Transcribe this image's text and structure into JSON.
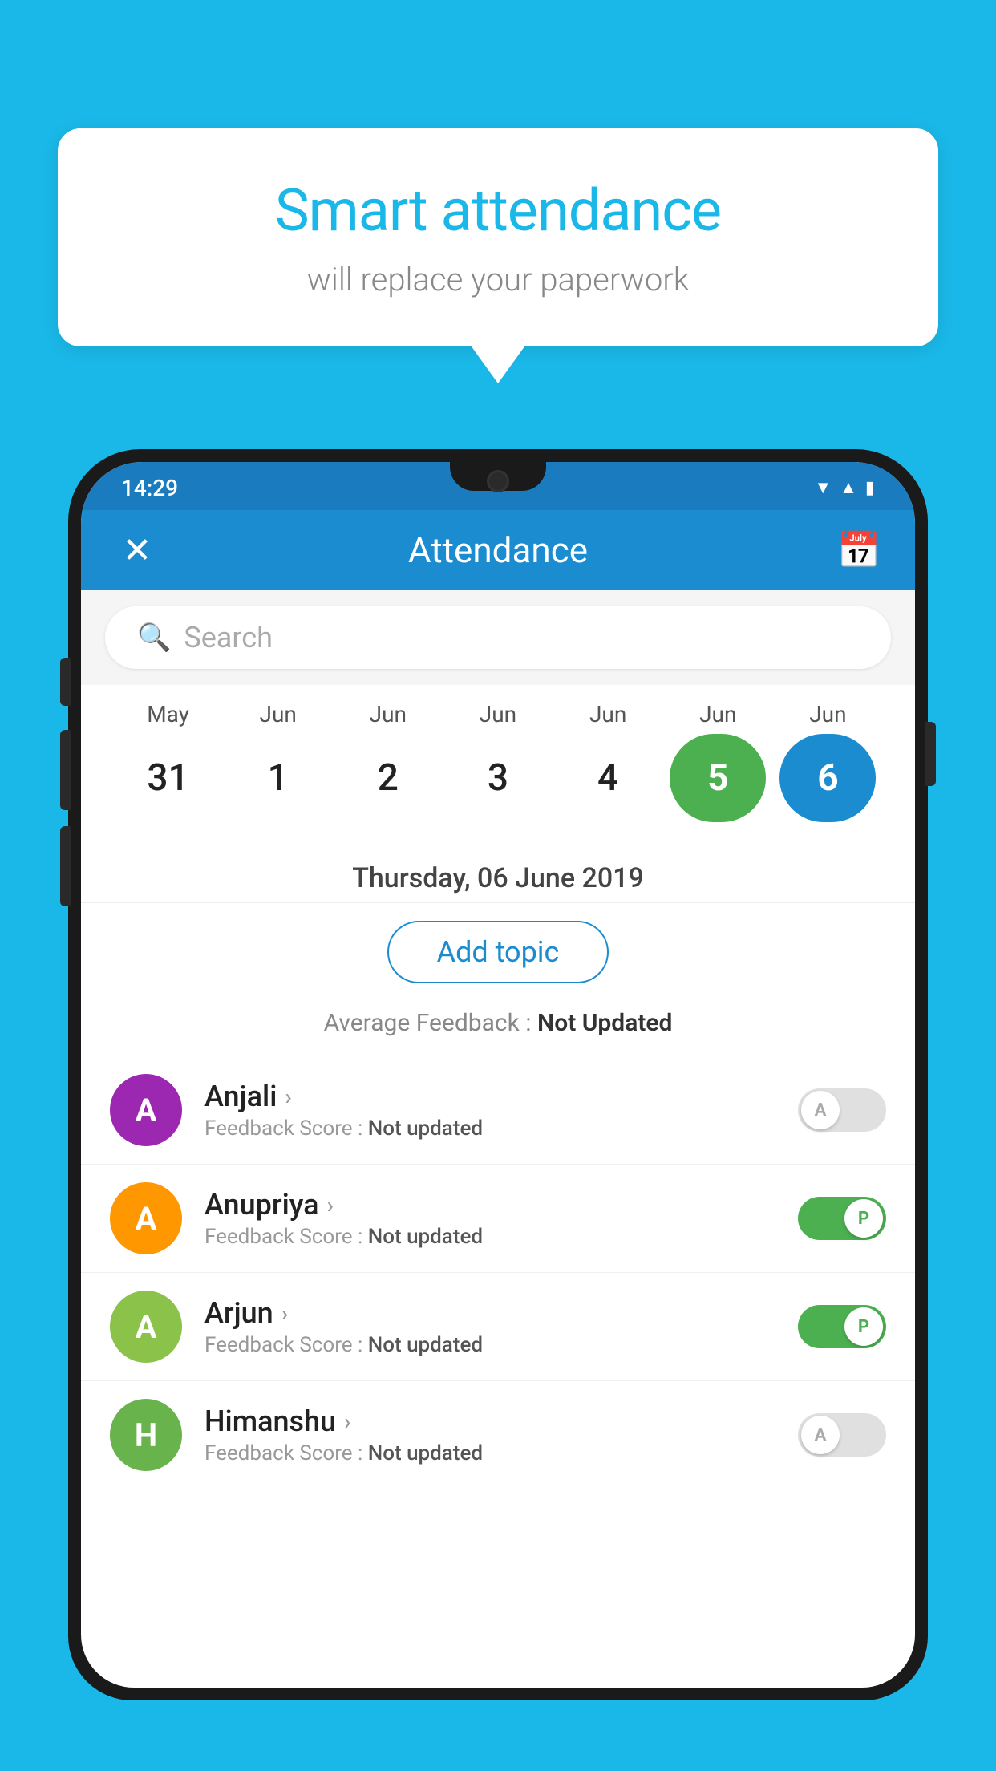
{
  "background": {
    "color": "#1ab8e8"
  },
  "speech_bubble": {
    "title": "Smart attendance",
    "subtitle": "will replace your paperwork"
  },
  "status_bar": {
    "time": "14:29"
  },
  "app_bar": {
    "title": "Attendance",
    "close_label": "✕",
    "calendar_label": "📅"
  },
  "search": {
    "placeholder": "Search"
  },
  "date_picker": {
    "dates": [
      {
        "month": "May",
        "day": "31",
        "state": "normal"
      },
      {
        "month": "Jun",
        "day": "1",
        "state": "normal"
      },
      {
        "month": "Jun",
        "day": "2",
        "state": "normal"
      },
      {
        "month": "Jun",
        "day": "3",
        "state": "normal"
      },
      {
        "month": "Jun",
        "day": "4",
        "state": "normal"
      },
      {
        "month": "Jun",
        "day": "5",
        "state": "today"
      },
      {
        "month": "Jun",
        "day": "6",
        "state": "selected"
      }
    ],
    "selected_date_text": "Thursday, 06 June 2019"
  },
  "add_topic": {
    "label": "Add topic"
  },
  "avg_feedback": {
    "label": "Average Feedback : ",
    "value": "Not Updated"
  },
  "students": [
    {
      "name": "Anjali",
      "initial": "A",
      "avatar_color": "purple",
      "feedback_label": "Feedback Score : ",
      "feedback_value": "Not updated",
      "toggle": "off",
      "toggle_label": "A"
    },
    {
      "name": "Anupriya",
      "initial": "A",
      "avatar_color": "orange",
      "feedback_label": "Feedback Score : ",
      "feedback_value": "Not updated",
      "toggle": "on",
      "toggle_label": "P"
    },
    {
      "name": "Arjun",
      "initial": "A",
      "avatar_color": "green",
      "feedback_label": "Feedback Score : ",
      "feedback_value": "Not updated",
      "toggle": "on",
      "toggle_label": "P"
    },
    {
      "name": "Himanshu",
      "initial": "H",
      "avatar_color": "green-dark",
      "feedback_label": "Feedback Score : ",
      "feedback_value": "Not updated",
      "toggle": "off",
      "toggle_label": "A"
    }
  ]
}
